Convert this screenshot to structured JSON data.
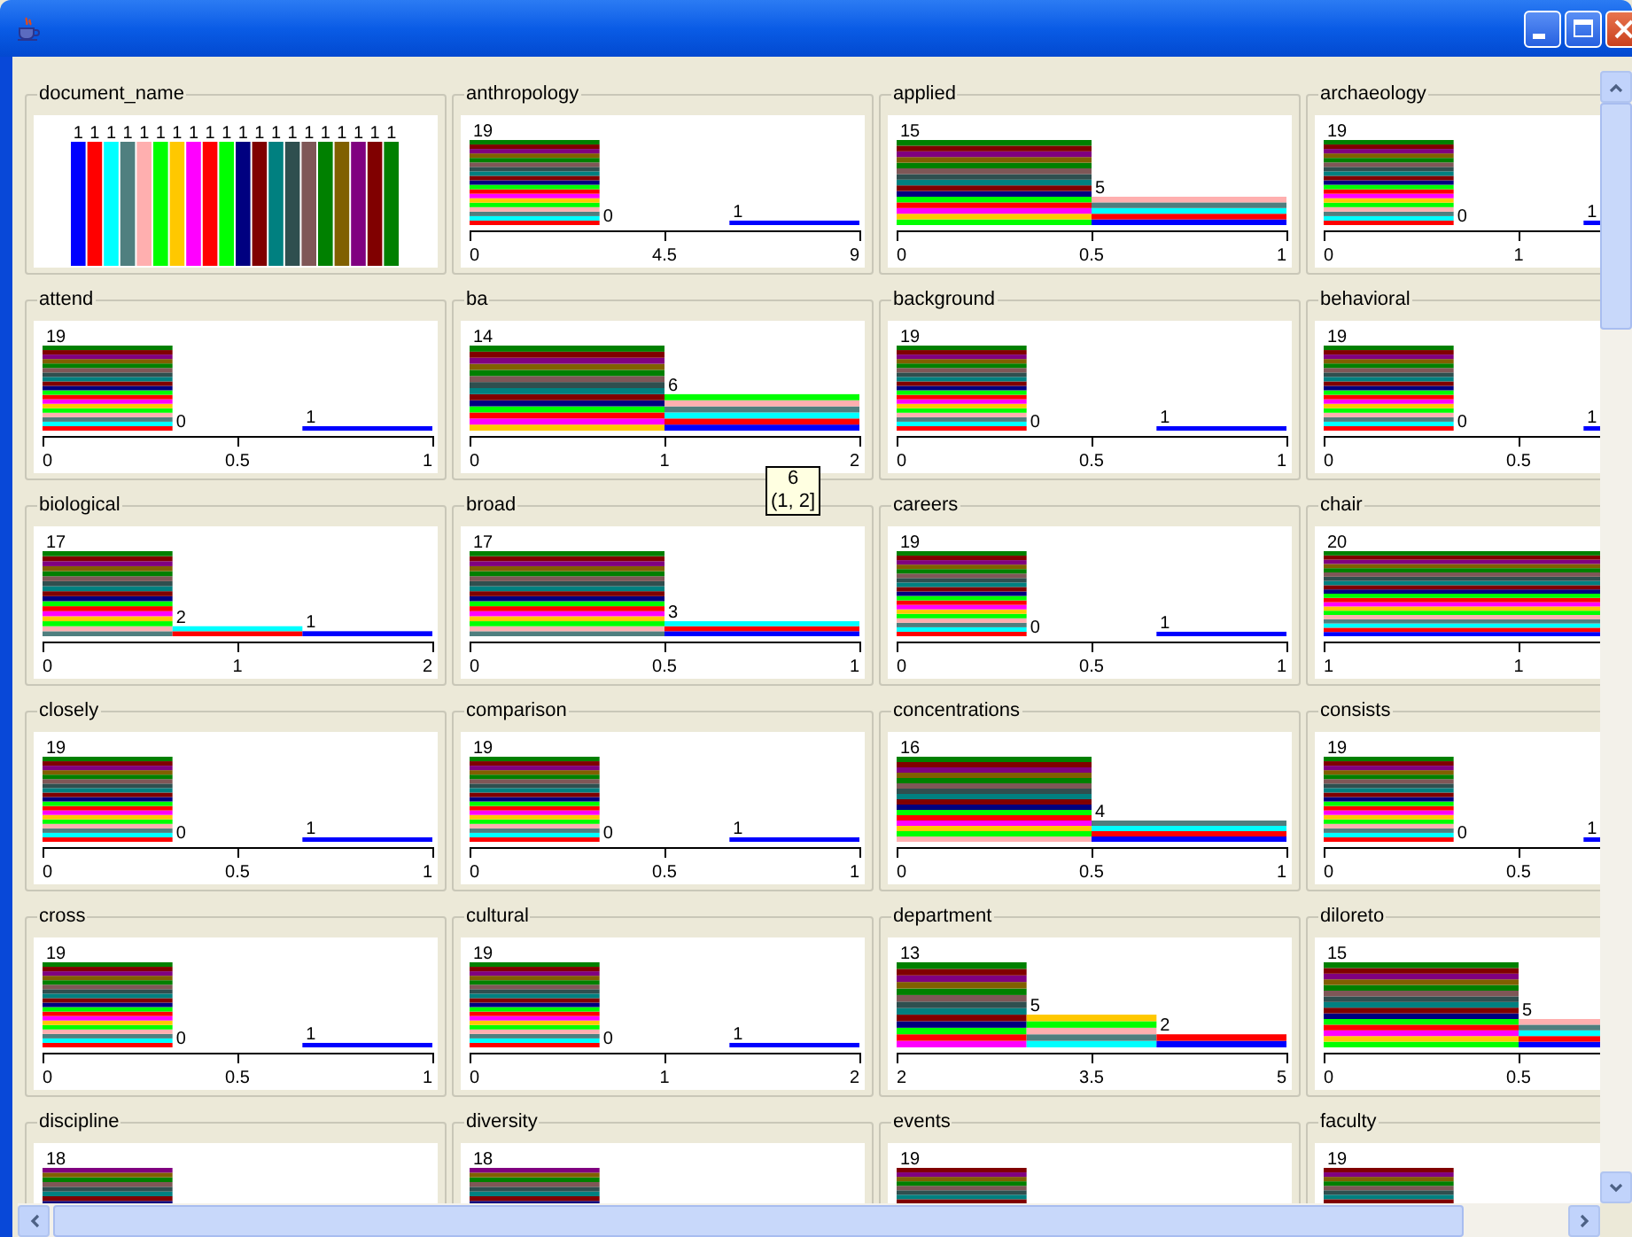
{
  "panels": [
    {
      "kind": "nominal",
      "title": "document_name",
      "bars": [
        {
          "count": "1"
        },
        {
          "count": "1"
        },
        {
          "count": "1"
        },
        {
          "count": "1"
        },
        {
          "count": "1"
        },
        {
          "count": "1"
        },
        {
          "count": "1"
        },
        {
          "count": "1"
        },
        {
          "count": "1"
        },
        {
          "count": "1"
        },
        {
          "count": "1"
        },
        {
          "count": "1"
        },
        {
          "count": "1"
        },
        {
          "count": "1"
        },
        {
          "count": "1"
        },
        {
          "count": "1"
        },
        {
          "count": "1"
        },
        {
          "count": "1"
        },
        {
          "count": "1"
        },
        {
          "count": "1"
        }
      ]
    },
    {
      "kind": "numeric",
      "title": "anthropology",
      "bars": [
        {
          "count": "19"
        },
        {
          "count": "0"
        },
        {
          "count": "1"
        }
      ],
      "ticks": [
        "0",
        "4.5",
        "9"
      ]
    },
    {
      "kind": "numeric",
      "title": "applied",
      "bars": [
        {
          "count": "15"
        },
        {
          "count": "5"
        }
      ],
      "ticks": [
        "0",
        "0.5",
        "1"
      ]
    },
    {
      "kind": "numeric",
      "title": "archaeology",
      "bars": [
        {
          "count": "19"
        },
        {
          "count": "0"
        },
        {
          "count": "1"
        }
      ],
      "ticks": [
        "0",
        "1"
      ]
    },
    {
      "kind": "numeric",
      "title": "attend",
      "bars": [
        {
          "count": "19"
        },
        {
          "count": "0"
        },
        {
          "count": "1"
        }
      ],
      "ticks": [
        "0",
        "0.5",
        "1"
      ]
    },
    {
      "kind": "numeric",
      "title": "ba",
      "bars": [
        {
          "count": "14"
        },
        {
          "count": "6"
        }
      ],
      "ticks": [
        "0",
        "1",
        "2"
      ]
    },
    {
      "kind": "numeric",
      "title": "background",
      "bars": [
        {
          "count": "19"
        },
        {
          "count": "0"
        },
        {
          "count": "1"
        }
      ],
      "ticks": [
        "0",
        "0.5",
        "1"
      ]
    },
    {
      "kind": "numeric",
      "title": "behavioral",
      "bars": [
        {
          "count": "19"
        },
        {
          "count": "0"
        },
        {
          "count": "1"
        }
      ],
      "ticks": [
        "0",
        "0.5"
      ]
    },
    {
      "kind": "numeric",
      "title": "biological",
      "bars": [
        {
          "count": "17"
        },
        {
          "count": "2"
        },
        {
          "count": "1"
        }
      ],
      "ticks": [
        "0",
        "1",
        "2"
      ]
    },
    {
      "kind": "numeric",
      "title": "broad",
      "bars": [
        {
          "count": "17"
        },
        {
          "count": "3"
        }
      ],
      "ticks": [
        "0",
        "0.5",
        "1"
      ]
    },
    {
      "kind": "numeric",
      "title": "careers",
      "bars": [
        {
          "count": "19"
        },
        {
          "count": "0"
        },
        {
          "count": "1"
        }
      ],
      "ticks": [
        "0",
        "0.5",
        "1"
      ]
    },
    {
      "kind": "numeric",
      "title": "chair",
      "bars": [
        {
          "count": "20"
        }
      ],
      "ticks": [
        "1",
        "1"
      ]
    },
    {
      "kind": "numeric",
      "title": "closely",
      "bars": [
        {
          "count": "19"
        },
        {
          "count": "0"
        },
        {
          "count": "1"
        }
      ],
      "ticks": [
        "0",
        "0.5",
        "1"
      ]
    },
    {
      "kind": "numeric",
      "title": "comparison",
      "bars": [
        {
          "count": "19"
        },
        {
          "count": "0"
        },
        {
          "count": "1"
        }
      ],
      "ticks": [
        "0",
        "0.5",
        "1"
      ]
    },
    {
      "kind": "numeric",
      "title": "concentrations",
      "bars": [
        {
          "count": "16"
        },
        {
          "count": "4"
        }
      ],
      "ticks": [
        "0",
        "0.5",
        "1"
      ]
    },
    {
      "kind": "numeric",
      "title": "consists",
      "bars": [
        {
          "count": "19"
        },
        {
          "count": "0"
        },
        {
          "count": "1"
        }
      ],
      "ticks": [
        "0",
        "0.5"
      ]
    },
    {
      "kind": "numeric",
      "title": "cross",
      "bars": [
        {
          "count": "19"
        },
        {
          "count": "0"
        },
        {
          "count": "1"
        }
      ],
      "ticks": [
        "0",
        "0.5",
        "1"
      ]
    },
    {
      "kind": "numeric",
      "title": "cultural",
      "bars": [
        {
          "count": "19"
        },
        {
          "count": "0"
        },
        {
          "count": "1"
        }
      ],
      "ticks": [
        "0",
        "1",
        "2"
      ]
    },
    {
      "kind": "numeric",
      "title": "department",
      "bars": [
        {
          "count": "13"
        },
        {
          "count": "5"
        },
        {
          "count": "2"
        }
      ],
      "ticks": [
        "2",
        "3.5",
        "5"
      ]
    },
    {
      "kind": "numeric",
      "title": "diloreto",
      "bars": [
        {
          "count": "15"
        },
        {
          "count": "5"
        }
      ],
      "ticks": [
        "0",
        "0.5"
      ]
    },
    {
      "kind": "numeric",
      "title": "discipline",
      "bars": [
        {
          "count": "18"
        }
      ],
      "cut_off": true
    },
    {
      "kind": "numeric",
      "title": "diversity",
      "bars": [
        {
          "count": "18"
        }
      ],
      "cut_off": true
    },
    {
      "kind": "numeric",
      "title": "events",
      "bars": [
        {
          "count": "19"
        }
      ],
      "cut_off": true
    },
    {
      "kind": "numeric",
      "title": "faculty",
      "bars": [
        {
          "count": "19"
        }
      ],
      "cut_off": true
    }
  ],
  "tooltip": {
    "lines": [
      "6",
      "(1, 2]"
    ]
  }
}
